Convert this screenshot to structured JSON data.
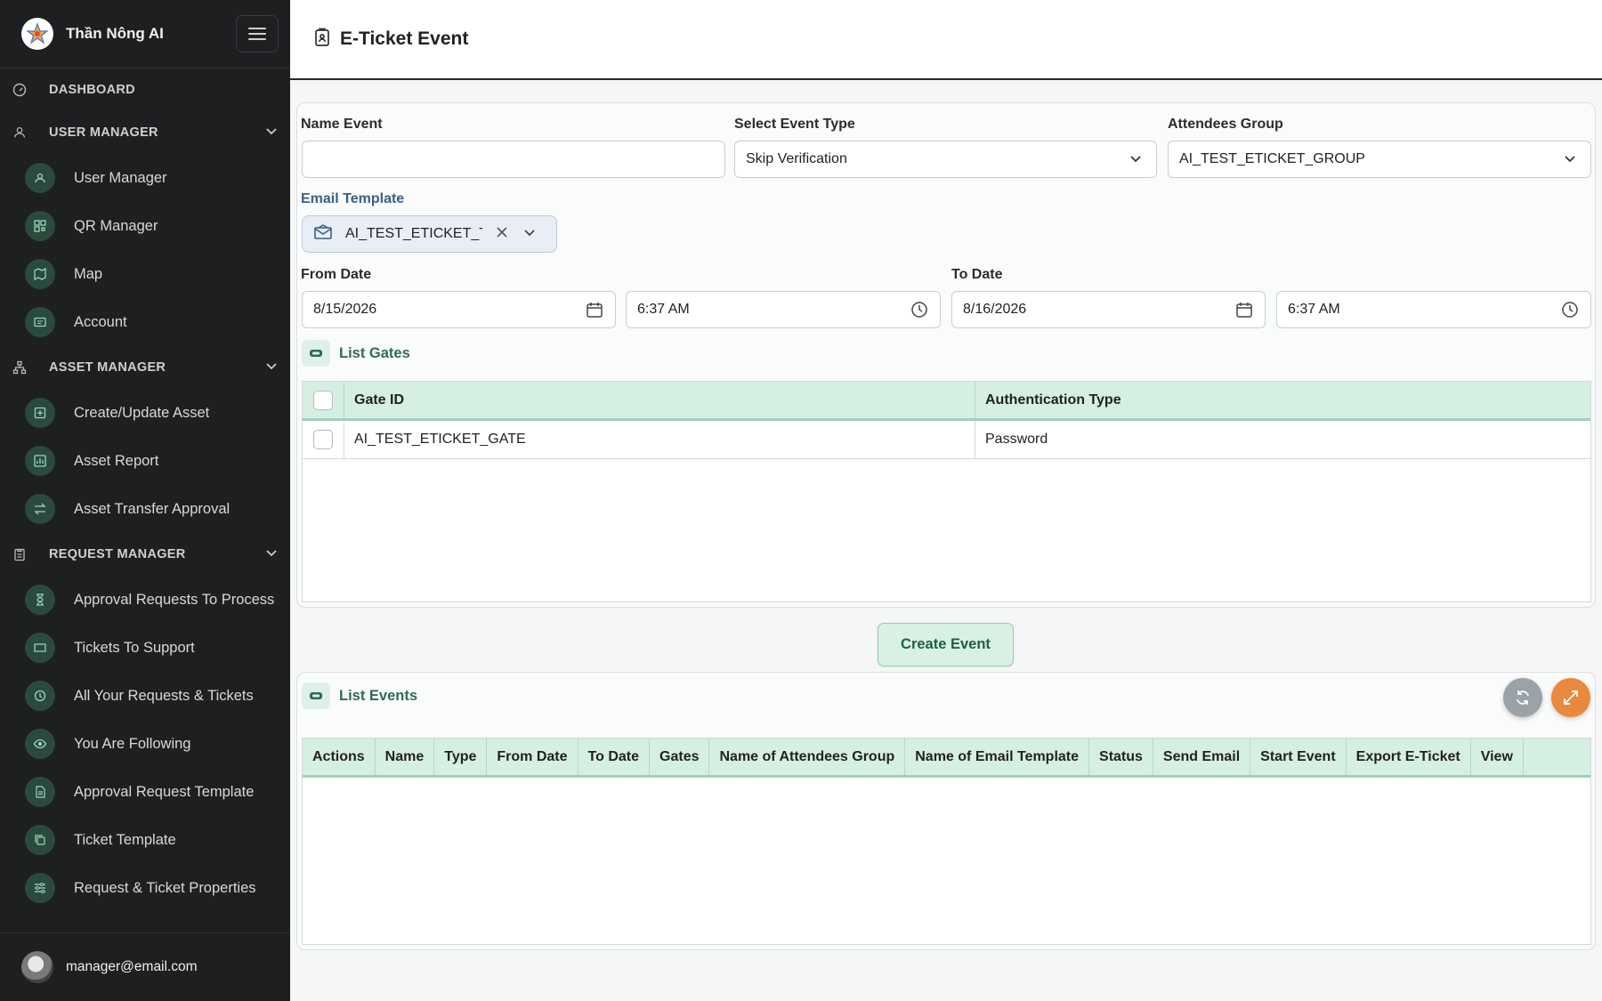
{
  "brand": {
    "name": "Thần Nông AI"
  },
  "sidebar": {
    "sections": [
      {
        "label": "DASHBOARD",
        "icon": "gauge-icon"
      },
      {
        "label": "USER MANAGER",
        "icon": "users-icon"
      },
      {
        "label": "ASSET MANAGER",
        "icon": "sitemap-icon"
      },
      {
        "label": "REQUEST MANAGER",
        "icon": "clipboard-icon"
      }
    ],
    "user_items": [
      {
        "label": "User Manager",
        "icon": "users-cog-icon"
      },
      {
        "label": "QR Manager",
        "icon": "qr-code-icon"
      },
      {
        "label": "Map",
        "icon": "map-icon"
      },
      {
        "label": "Account",
        "icon": "id-card-icon"
      }
    ],
    "asset_items": [
      {
        "label": "Create/Update Asset",
        "icon": "plus-square-icon"
      },
      {
        "label": "Asset Report",
        "icon": "bar-chart-icon"
      },
      {
        "label": "Asset Transfer Approval",
        "icon": "transfer-icon"
      }
    ],
    "request_items": [
      {
        "label": "Approval Requests To Process",
        "icon": "hourglass-icon"
      },
      {
        "label": "Tickets To Support",
        "icon": "ticket-icon"
      },
      {
        "label": "All Your Requests & Tickets",
        "icon": "history-icon"
      },
      {
        "label": "You Are Following",
        "icon": "eye-icon"
      },
      {
        "label": "Approval Request Template",
        "icon": "file-text-icon"
      },
      {
        "label": "Ticket Template",
        "icon": "copy-icon"
      },
      {
        "label": "Request & Ticket Properties",
        "icon": "sliders-icon"
      }
    ],
    "user_email": "manager@email.com"
  },
  "header": {
    "title": "E-Ticket Event"
  },
  "form": {
    "name_event": {
      "label": "Name Event",
      "value": ""
    },
    "event_type": {
      "label": "Select Event Type",
      "value": "Skip Verification"
    },
    "attendees_group": {
      "label": "Attendees Group",
      "value": "AI_TEST_ETICKET_GROUP"
    },
    "email_template": {
      "label": "Email Template",
      "value": "AI_TEST_ETICKET_TI"
    },
    "from_date": {
      "label": "From Date",
      "date": "8/15/2026",
      "time": "6:37 AM"
    },
    "to_date": {
      "label": "To Date",
      "date": "8/16/2026",
      "time": "6:37 AM"
    }
  },
  "gates": {
    "title": "List Gates",
    "columns": [
      "Gate ID",
      "Authentication Type"
    ],
    "rows": [
      {
        "gate_id": "AI_TEST_ETICKET_GATE",
        "auth_type": "Password"
      }
    ]
  },
  "create_button": "Create Event",
  "events": {
    "title": "List Events",
    "columns": [
      "Actions",
      "Name",
      "Type",
      "From Date",
      "To Date",
      "Gates",
      "Name of Attendees Group",
      "Name of Email Template",
      "Status",
      "Send Email",
      "Start Event",
      "Export E-Ticket",
      "View"
    ]
  },
  "colors": {
    "accent": "#2f6b57",
    "sidebar_bg": "#1e1f21",
    "header_row_bg": "#d6efe3"
  }
}
